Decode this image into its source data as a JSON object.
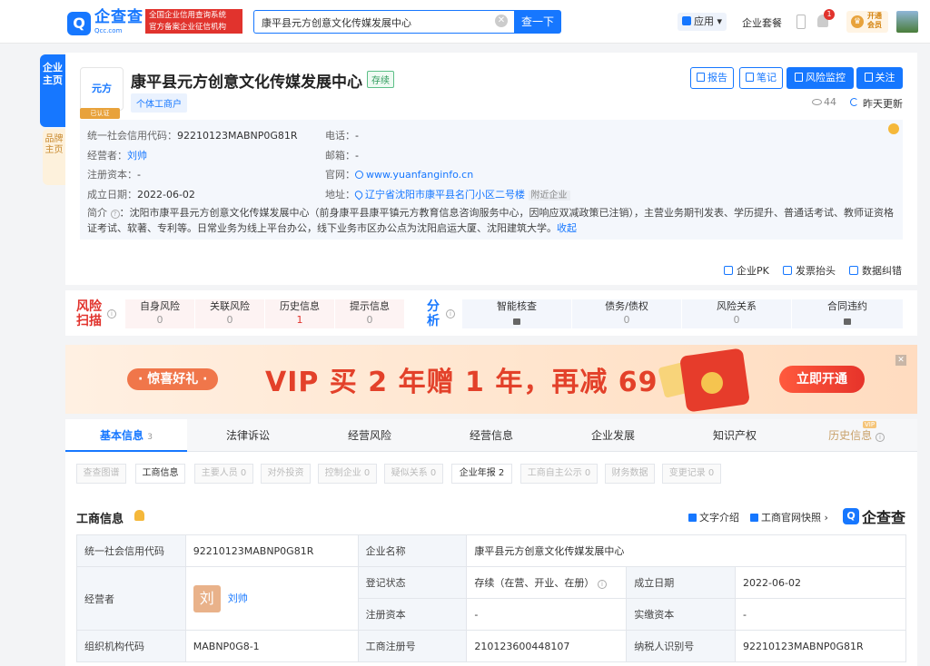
{
  "header": {
    "logo_text": "企查查",
    "logo_sub": "Qcc.com",
    "badge_line1": "全国企业信用查询系统",
    "badge_line2": "官方备案企业征信机构",
    "search_value": "康平县元方创意文化传媒发展中心",
    "search_button": "查一下",
    "apps_label": "应用",
    "packages_label": "企业套餐",
    "notification_count": "1",
    "vip_line1": "开通",
    "vip_line2": "会员"
  },
  "side_tabs": {
    "company_home": "企业主页",
    "brand_home": "品牌主页"
  },
  "company": {
    "logo_text": "元方",
    "certified": "已认证",
    "name": "康平县元方创意文化传媒发展中心",
    "status": "存续",
    "type": "个体工商户",
    "actions": [
      "报告",
      "笔记",
      "风险监控",
      "关注"
    ],
    "views": "44",
    "updated": "昨天更新",
    "info": {
      "credit_code_label": "统一社会信用代码：",
      "credit_code": "92210123MABNP0G81R",
      "operator_label": "经营者：",
      "operator": "刘帅",
      "capital_label": "注册资本：",
      "capital": "-",
      "founded_label": "成立日期：",
      "founded": "2022-06-02",
      "phone_label": "电话：",
      "phone": "-",
      "email_label": "邮箱：",
      "email": "-",
      "website_label": "官网：",
      "website": "www.yuanfanginfo.cn",
      "address_label": "地址：",
      "address": "辽宁省沈阳市康平县名门小区二号楼",
      "nearby": "附近企业",
      "intro_label": "简介",
      "intro_text": "：沈阳市康平县元方创意文化传媒发展中心（前身康平县康平镇元方教育信息咨询服务中心，因响应双减政策已注销），主营业务期刊发表、学历提升、普通话考试、教师证资格证考试、软著、专利等。日常业务为线上平台办公，线下业务市区办公点为沈阳启运大厦、沈阳建筑大学。",
      "collapse": "收起"
    },
    "tools": [
      "企业PK",
      "发票抬头",
      "数据纠错"
    ]
  },
  "risk": {
    "title": "风险扫描",
    "items": [
      {
        "label": "自身风险",
        "value": "0"
      },
      {
        "label": "关联风险",
        "value": "0"
      },
      {
        "label": "历史信息",
        "value": "1"
      },
      {
        "label": "提示信息",
        "value": "0"
      }
    ]
  },
  "analysis": {
    "title": "分析",
    "items": [
      {
        "label": "智能核查",
        "value": ""
      },
      {
        "label": "债务/债权",
        "value": "0"
      },
      {
        "label": "风险关系",
        "value": "0"
      },
      {
        "label": "合同违约",
        "value": ""
      }
    ]
  },
  "banner": {
    "gift": "· 惊喜好礼 ·",
    "promo": "VIP 买 2 年赠 1 年，再减 69 元",
    "button": "立即开通",
    "close": "✕"
  },
  "tabs": [
    {
      "label": "基本信息",
      "count": "3"
    },
    {
      "label": "法律诉讼",
      "count": ""
    },
    {
      "label": "经营风险",
      "count": ""
    },
    {
      "label": "经营信息",
      "count": ""
    },
    {
      "label": "企业发展",
      "count": ""
    },
    {
      "label": "知识产权",
      "count": ""
    },
    {
      "label": "历史信息",
      "count": ""
    }
  ],
  "vip_tag": "VIP",
  "subtabs": [
    "查查图谱",
    "工商信息",
    "主要人员 0",
    "对外投资",
    "控制企业 0",
    "疑似关系 0",
    "企业年报 2",
    "工商自主公示 0",
    "财务数据",
    "变更记录 0"
  ],
  "section": {
    "title": "工商信息",
    "text_intro": "文字介绍",
    "gov_snapshot": "工商官网快照 ›",
    "brand": "企查查"
  },
  "table": {
    "credit_code_k": "统一社会信用代码",
    "credit_code_v": "92210123MABNP0G81R",
    "name_k": "企业名称",
    "name_v": "康平县元方创意文化传媒发展中心",
    "operator_k": "经营者",
    "operator_avatar": "刘",
    "operator_v": "刘帅",
    "reg_status_k": "登记状态",
    "reg_status_v": "存续（在营、开业、在册）",
    "founded_k": "成立日期",
    "founded_v": "2022-06-02",
    "capital_k": "注册资本",
    "capital_v": "-",
    "paid_k": "实缴资本",
    "paid_v": "-",
    "org_code_k": "组织机构代码",
    "org_code_v": "MABNP0G8-1",
    "reg_no_k": "工商注册号",
    "reg_no_v": "210123600448107",
    "tax_k": "纳税人识别号",
    "tax_v": "92210123MABNP0G81R"
  },
  "colors": {
    "primary": "#1677ff",
    "danger": "#e1332d",
    "banner_red": "#e3412a"
  }
}
